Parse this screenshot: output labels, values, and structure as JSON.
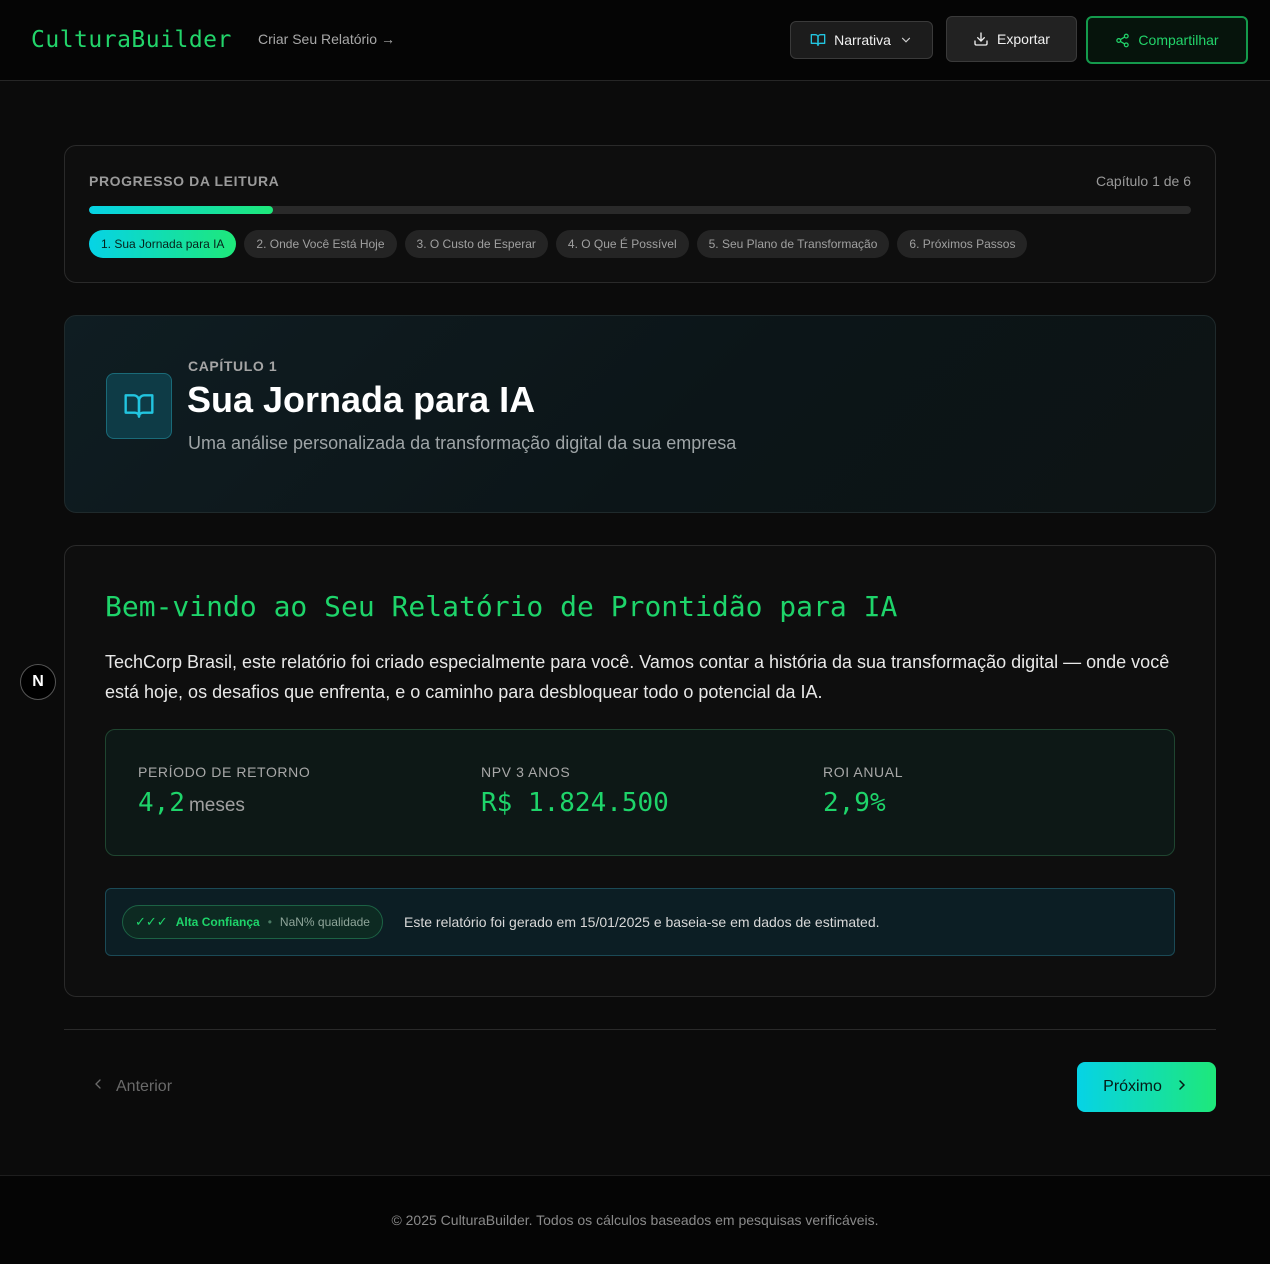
{
  "header": {
    "logo": "CulturaBuilder",
    "create_link": "Criar Seu Relatório →",
    "narrativa_label": "Narrativa",
    "exportar_label": "Exportar",
    "compartilhar_label": "Compartilhar"
  },
  "progress": {
    "title": "PROGRESSO DA LEITURA",
    "count": "Capítulo 1 de 6",
    "fraction": 0.1667,
    "chapters": [
      {
        "label": "1. Sua Jornada para IA",
        "active": true
      },
      {
        "label": "2. Onde Você Está Hoje",
        "active": false
      },
      {
        "label": "3. O Custo de Esperar",
        "active": false
      },
      {
        "label": "4. O Que É Possível",
        "active": false
      },
      {
        "label": "5. Seu Plano de Transformação",
        "active": false
      },
      {
        "label": "6. Próximos Passos",
        "active": false
      }
    ]
  },
  "chapter": {
    "kicker": "CAPÍTULO 1",
    "title": "Sua Jornada para IA",
    "subtitle": "Uma análise personalizada da transformação digital da sua empresa"
  },
  "content": {
    "welcome_title": "Bem-vindo ao Seu Relatório de Prontidão para IA",
    "welcome_text": "TechCorp Brasil, este relatório foi criado especialmente para você. Vamos contar a história da sua transformação digital — onde você está hoje, os desafios que enfrenta, e o caminho para desbloquear todo o potencial da IA.",
    "metrics": [
      {
        "label": "PERÍODO DE RETORNO",
        "value": "4,2",
        "unit": "meses"
      },
      {
        "label": "NPV 3 ANOS",
        "value": "R$ 1.824.500",
        "unit": ""
      },
      {
        "label": "ROI ANUAL",
        "value": "2,9%",
        "unit": ""
      }
    ],
    "notice": {
      "checks": "✓✓✓",
      "confidence": "Alta Confiança",
      "separator": "•",
      "quality": "NaN% qualidade",
      "text": "Este relatório foi gerado em 15/01/2025 e baseia-se em dados de estimated."
    }
  },
  "nav": {
    "badge": "N",
    "prev_label": "Anterior",
    "next_label": "Próximo"
  },
  "footer": {
    "text": "© 2025 CulturaBuilder. Todos os cálculos baseados em pesquisas verificáveis."
  },
  "colors": {
    "accent_green": "#1ed46a",
    "accent_cyan": "#06d3e6",
    "background": "#0b0b0b"
  }
}
